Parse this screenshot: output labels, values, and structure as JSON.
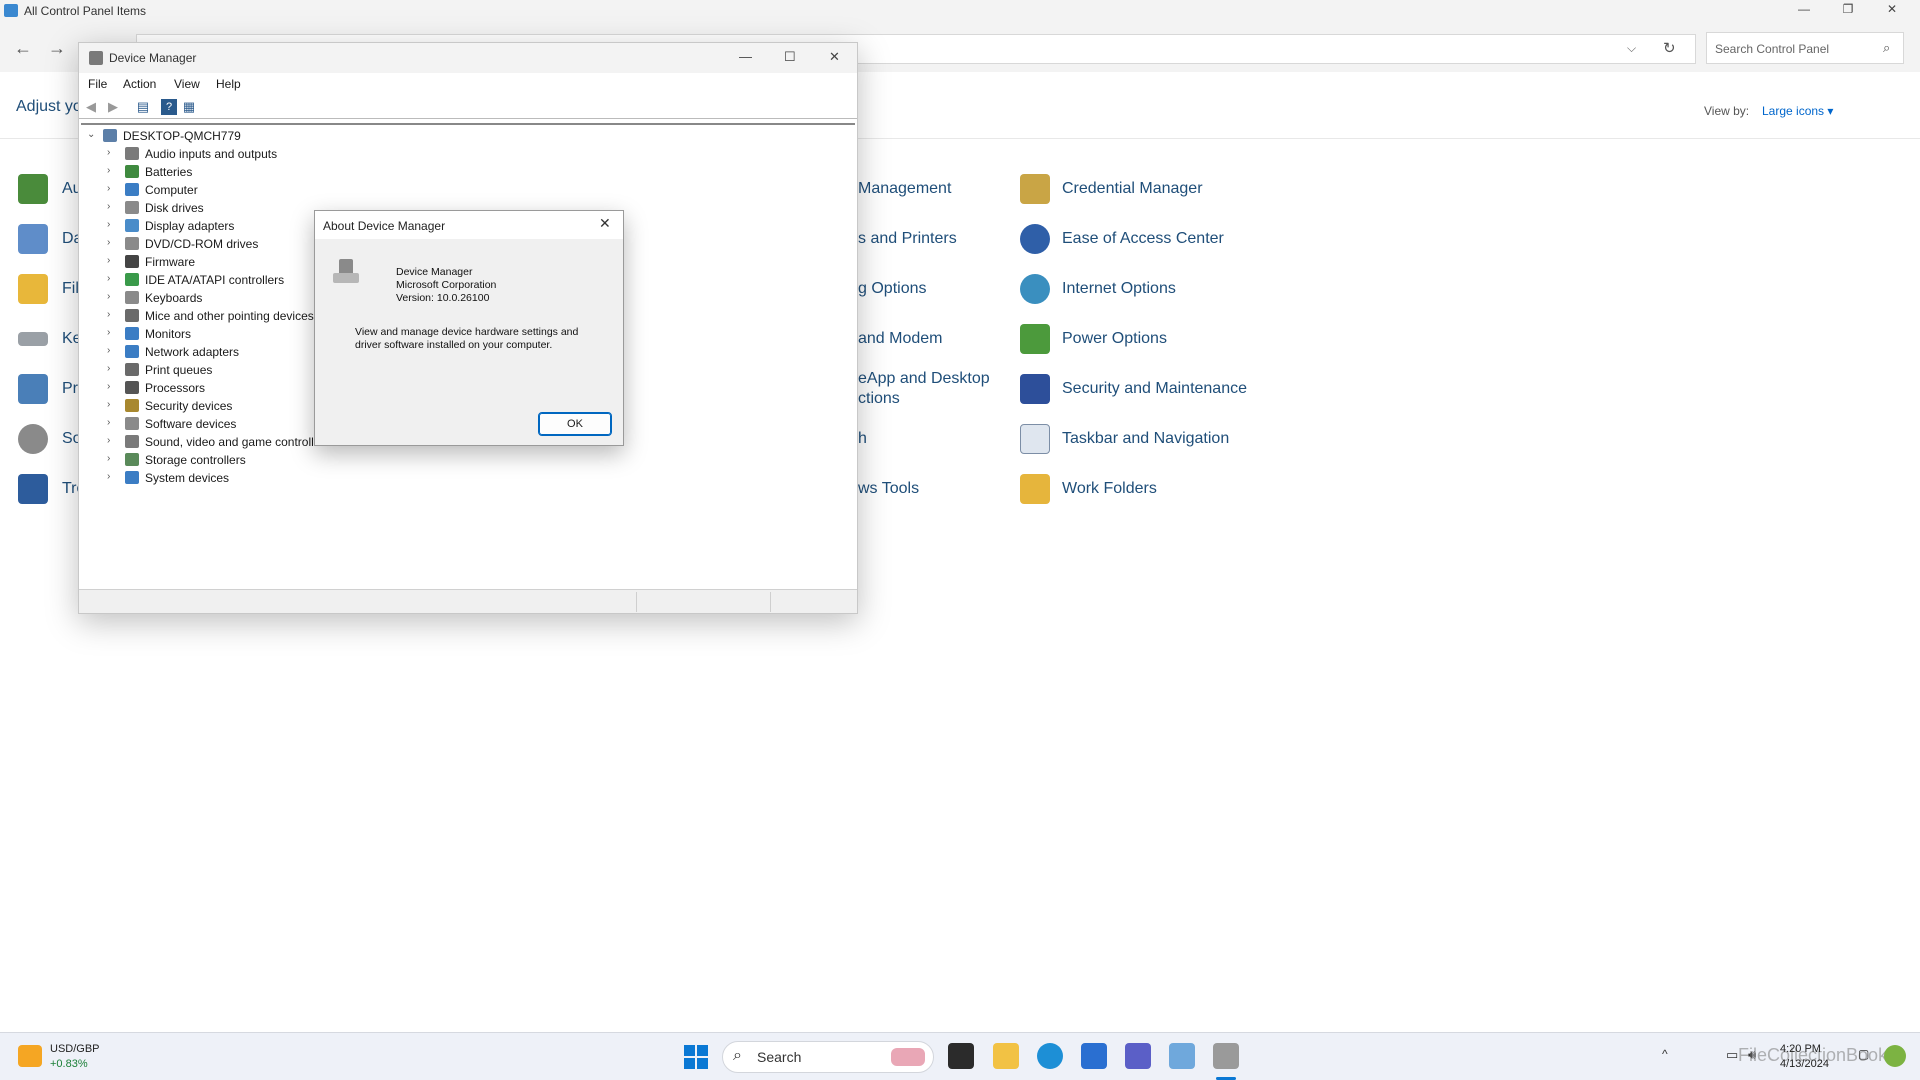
{
  "control_panel": {
    "title": "All Control Panel Items",
    "search_placeholder": "Search Control Panel",
    "heading_partial": "Adjust yo",
    "view_by_label": "View by:",
    "view_by_value": "Large icons ▾",
    "left_column": [
      "Au",
      "Da",
      "Fil",
      "Ke",
      "Pr",
      "So",
      "Tro"
    ],
    "middle_column": [
      "Management",
      "s and Printers",
      "g Options",
      "and Modem",
      "eApp and Desktop",
      "ctions",
      "h",
      "ws Tools"
    ],
    "right_column": [
      "Credential Manager",
      "Ease of Access Center",
      "Internet Options",
      "Power Options",
      "Security and Maintenance",
      "Taskbar and Navigation",
      "Work Folders"
    ]
  },
  "device_manager": {
    "title": "Device Manager",
    "menu": [
      "File",
      "Action",
      "View",
      "Help"
    ],
    "root": "DESKTOP-QMCH779",
    "categories": [
      "Audio inputs and outputs",
      "Batteries",
      "Computer",
      "Disk drives",
      "Display adapters",
      "DVD/CD-ROM drives",
      "Firmware",
      "IDE ATA/ATAPI controllers",
      "Keyboards",
      "Mice and other pointing devices",
      "Monitors",
      "Network adapters",
      "Print queues",
      "Processors",
      "Security devices",
      "Software devices",
      "Sound, video and game controlle",
      "Storage controllers",
      "System devices"
    ]
  },
  "about_dialog": {
    "title": "About Device Manager",
    "product": "Device Manager",
    "company": "Microsoft Corporation",
    "version": "Version: 10.0.26100",
    "description_line1": "View and manage device hardware settings and",
    "description_line2": "driver software installed on your computer.",
    "ok_label": "OK"
  },
  "taskbar": {
    "weather_name": "USD/GBP",
    "weather_value": "+0.83%",
    "search_label": "Search",
    "time": "4:20 PM",
    "date": "4/13/2024",
    "watermark": "FileCollectionBook"
  },
  "colors": {
    "link": "#1f4e79",
    "accent": "#0067c0"
  }
}
